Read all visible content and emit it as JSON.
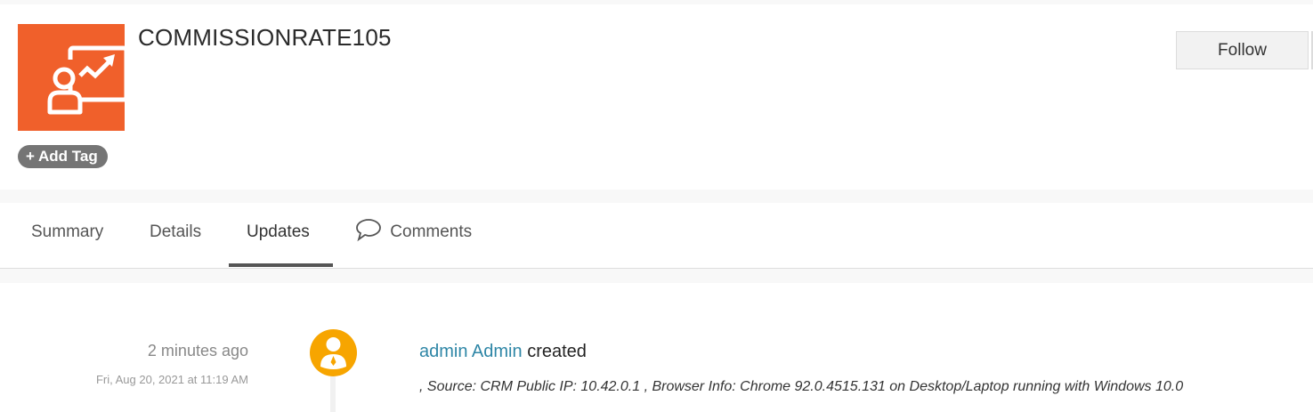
{
  "header": {
    "title": "COMMISSIONRATE105",
    "add_tag": "+ Add Tag",
    "follow": "Follow",
    "logo_icon": "presentation-chart-icon",
    "brand_color": "#f0602b"
  },
  "tabs": [
    {
      "label": "Summary"
    },
    {
      "label": "Details"
    },
    {
      "label": "Updates",
      "active": true
    },
    {
      "label": "Comments",
      "icon": "speech-bubble-icon"
    }
  ],
  "updates": [
    {
      "relative_time": "2 minutes ago",
      "date": "Fri, Aug 20, 2021 at 11:19 AM",
      "user": "admin Admin",
      "action": "created",
      "info": ", Source: CRM Public IP: 10.42.0.1 , Browser Info: Chrome 92.0.4515.131 on Desktop/Laptop running with Windows 10.0"
    }
  ]
}
